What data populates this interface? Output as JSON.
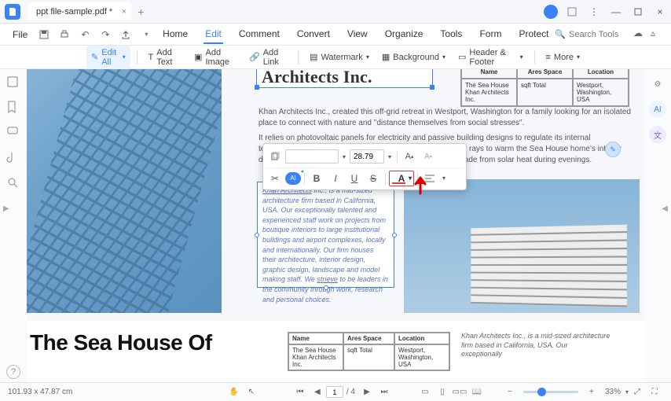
{
  "window": {
    "tab_title": "ppt file-sample.pdf *"
  },
  "menu": {
    "file": "File",
    "items": [
      "Home",
      "Edit",
      "Comment",
      "Convert",
      "View",
      "Organize",
      "Tools",
      "Form",
      "Protect"
    ],
    "active_index": 1,
    "search_placeholder": "Search Tools"
  },
  "toolbar": {
    "edit_all": "Edit All",
    "add_text": "Add Text",
    "add_image": "Add Image",
    "add_link": "Add Link",
    "watermark": "Watermark",
    "background": "Background",
    "header_footer": "Header & Footer",
    "more": "More"
  },
  "document": {
    "title_box": "Architects Inc.",
    "info_headers": [
      "Name",
      "Ares Space",
      "Location"
    ],
    "info_row": [
      "The Sea House Khan Architects Inc.",
      "sqft Total",
      "Westport, Washington, USA"
    ],
    "para1": "Khan Architects Inc., created this off-grid retreat in Westport, Washington for a family looking for an isolated place to connect with nature and \"distance themselves from social stresses\".",
    "para2": "It relies on photovoltaic panels for electricity and passive building designs to regulate its internal temperature. This includes glazed areas that allow the sun's rays to warm the Sea House home's interior during winter. In Summer, the overhanging roof provides shade from solar heat during evenings.",
    "selected_text": "Khan Architects Inc., is a mid-sized architecture firm based in California, USA. Our exceptionally talented and experienced staff work on projects from boutique interiors to large institutional buildings and airport complexes, locally and internationally. Our firm houses their architecture, interior design, graphic design, landscape and model making staff. We strieve to be leaders in the community through work, research and personal choices.",
    "selected_underline_lead": "Khan Architects",
    "underline_word": "strieve",
    "page2_headline": "The Sea House Of",
    "page2_side": "Khan Architects Inc., is a mid-sized architecture firm based in California, USA. Our exceptionally"
  },
  "format_toolbar": {
    "font_size": "28.79"
  },
  "statusbar": {
    "dimensions": "101.93 x 47.87 cm",
    "page_current": "1",
    "page_total": "/ 4",
    "zoom": "33%"
  },
  "colors": {
    "accent": "#3b82f6",
    "highlight": "#d93a3a"
  }
}
